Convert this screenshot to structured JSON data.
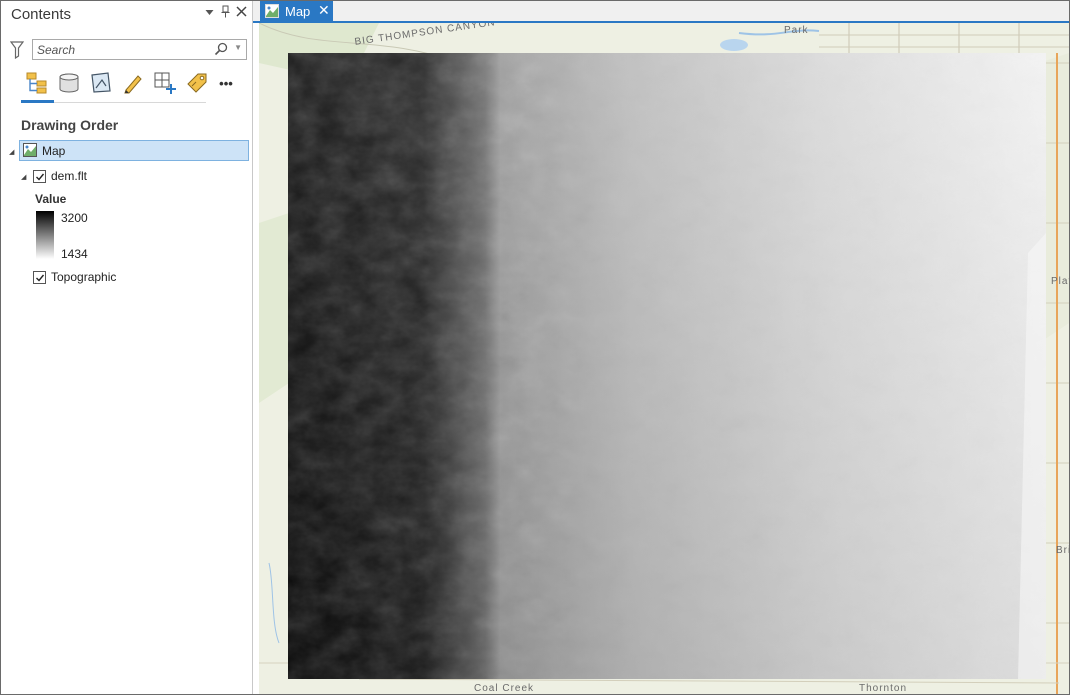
{
  "contents": {
    "title": "Contents",
    "search": {
      "placeholder": "Search",
      "value": ""
    },
    "toolbar": [
      "list-by-drawing-order",
      "list-by-source",
      "list-by-selection",
      "list-by-editing",
      "list-by-snapping",
      "list-by-labeling",
      "more"
    ],
    "more_label": "•••",
    "section_title": "Drawing Order",
    "map_node": {
      "label": "Map",
      "expanded": true,
      "selected": true
    },
    "layers": [
      {
        "label": "dem.flt",
        "checked": true,
        "expanded": true,
        "legend": {
          "field": "Value",
          "high": "3200",
          "low": "1434",
          "ramp": [
            "#000000",
            "#ffffff"
          ]
        }
      },
      {
        "label": "Topographic",
        "checked": true,
        "expanded": false
      }
    ]
  },
  "map_view": {
    "tab_label": "Map",
    "basemap_labels": [
      "BIG THOMPSON CANYON",
      "Park",
      "Platt",
      "Bri",
      "Thornton",
      "Coal Creek"
    ]
  },
  "colors": {
    "accent": "#2a78c4",
    "selection_fill": "#cde3f7",
    "selection_border": "#7eb2e0"
  }
}
